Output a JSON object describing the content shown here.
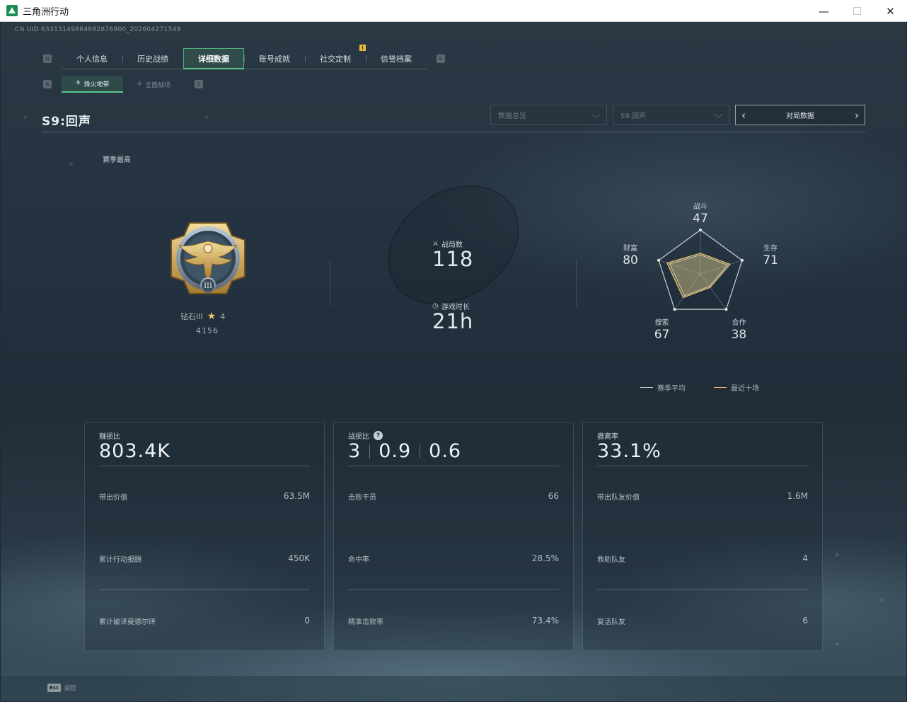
{
  "window": {
    "title": "三角洲行动",
    "minimize": "—",
    "maximize": "☐",
    "close": "✕"
  },
  "uid": "CN UID 63313149864682876900_202604271549",
  "nav": {
    "left_key": "Q",
    "right_key": "E",
    "tabs": [
      {
        "label": "个人信息"
      },
      {
        "label": "历史战绩"
      },
      {
        "label": "详细数据",
        "active": true
      },
      {
        "label": "账号成就"
      },
      {
        "label": "社交定制",
        "badge": "!"
      },
      {
        "label": "信誉档案"
      }
    ],
    "active_color": "#5fc48a",
    "badge_color": "#e8b940"
  },
  "subnav": {
    "left_key": "A",
    "right_key": "D",
    "tabs": [
      {
        "label": "烽火地带",
        "icon": "compass-icon",
        "active": true
      },
      {
        "label": "全面战场",
        "icon": "crosshair-icon"
      }
    ]
  },
  "season_title": "S9:回声",
  "filters": {
    "dropdown1": "数据总览",
    "dropdown2": "S9:回声",
    "pager_label": "对局数据"
  },
  "rank": {
    "season_best_label": "赛季最高",
    "name": "钻石III",
    "stars": "4",
    "score": "4156",
    "medal_numeral": "III"
  },
  "stats": {
    "matches_label": "战局数",
    "matches_value": "118",
    "playtime_label": "游戏时长",
    "playtime_value": "21h"
  },
  "radar": {
    "axes": [
      {
        "label": "战斗",
        "value": "47"
      },
      {
        "label": "生存",
        "value": "71"
      },
      {
        "label": "合作",
        "value": "38"
      },
      {
        "label": "搜索",
        "value": "67"
      },
      {
        "label": "财富",
        "value": "80"
      }
    ],
    "legend": [
      {
        "label": "赛季平均",
        "color": "#c8d0d6"
      },
      {
        "label": "最近十场",
        "color": "#e8c870"
      }
    ]
  },
  "cards": [
    {
      "title": "赚损比",
      "big": [
        "803.4K"
      ],
      "rows": [
        {
          "label": "带出价值",
          "value": "63.5M"
        },
        {
          "label": "累计行动报酬",
          "value": "450K"
        },
        {
          "label": "累计破译曼德尔砖",
          "value": "0"
        }
      ]
    },
    {
      "title": "战损比",
      "help": "?",
      "big": [
        "3",
        "0.9",
        "0.6"
      ],
      "rows": [
        {
          "label": "击败干员",
          "value": "66"
        },
        {
          "label": "命中率",
          "value": "28.5%"
        },
        {
          "label": "精准击败率",
          "value": "73.4%"
        }
      ]
    },
    {
      "title": "撤离率",
      "big": [
        "33.1%"
      ],
      "rows": [
        {
          "label": "带出队友价值",
          "value": "1.6M"
        },
        {
          "label": "救助队友",
          "value": "4"
        },
        {
          "label": "复活队友",
          "value": "6"
        }
      ]
    }
  ],
  "footer": {
    "esc_key": "Esc",
    "esc_label": "返回"
  }
}
